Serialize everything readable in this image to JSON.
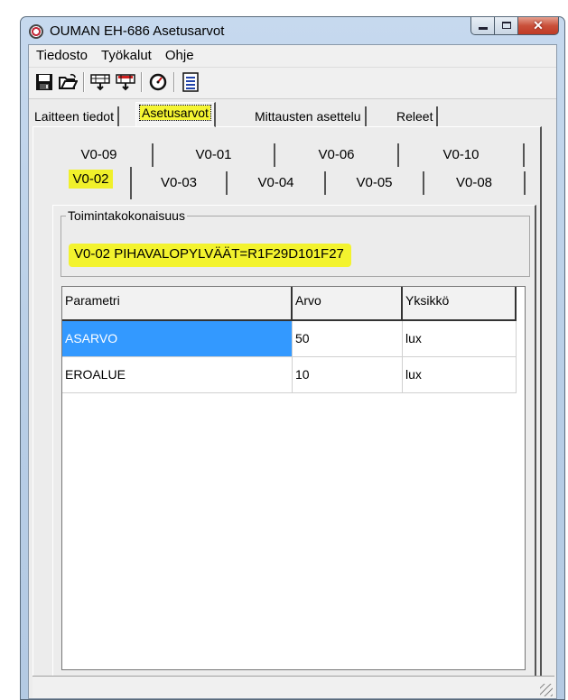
{
  "window": {
    "title": "OUMAN EH-686 Asetusarvot"
  },
  "menu": [
    "Tiedosto",
    "Työkalut",
    "Ohje"
  ],
  "toolbar": {
    "buttons": [
      "save-icon",
      "open-folder-icon",
      "download-icon",
      "upload-icon",
      "gauge-icon",
      "document-list-icon"
    ]
  },
  "outer_tabs": [
    {
      "label": "Laitteen tiedot",
      "selected": false
    },
    {
      "label": "Asetusarvot",
      "selected": true
    },
    {
      "label": "Mittausten asettelu",
      "selected": false
    },
    {
      "label": "Releet",
      "selected": false
    }
  ],
  "inner_tabs": {
    "back_row": [
      "V0-09",
      "V0-01",
      "V0-06",
      "V0-10"
    ],
    "front_row": [
      "V0-02",
      "V0-03",
      "V0-04",
      "V0-05",
      "V0-08"
    ],
    "selected": "V0-02"
  },
  "group": {
    "legend": "Toimintakokonaisuus",
    "value": "V0-02 PIHAVALOPYLVÄÄT=R1F29D101F27"
  },
  "table": {
    "headers": [
      "Parametri",
      "Arvo",
      "Yksikkö"
    ],
    "rows": [
      {
        "param": "ASARVO",
        "value": "50",
        "unit": "lux",
        "selected": true
      },
      {
        "param": "EROALUE",
        "value": "10",
        "unit": "lux",
        "selected": false
      }
    ]
  },
  "colors": {
    "highlight": "#f3f32e",
    "selection": "#3399ff",
    "close_button": "#c9503a"
  }
}
